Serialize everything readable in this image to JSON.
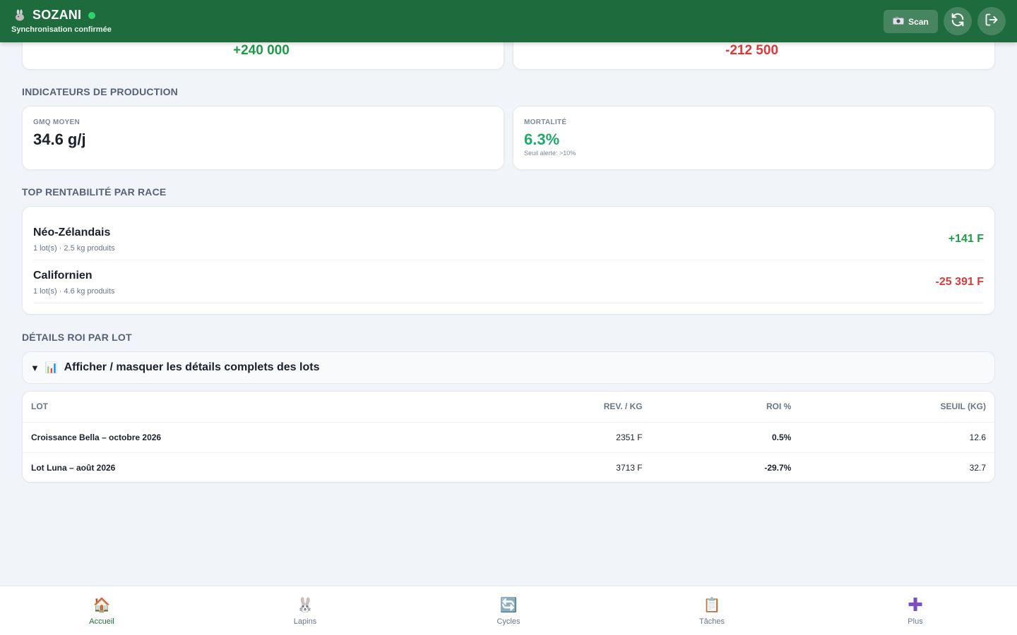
{
  "header": {
    "brand": "SOZANI",
    "subtitle": "Synchronisation confirmée",
    "scan_label": "Scan",
    "brand_icon": "rabbit-icon",
    "colors": {
      "bar": "#1e6b3e",
      "status": "#2fd26b"
    }
  },
  "summary": {
    "left_value": "+240 000",
    "right_value": "-212 500"
  },
  "production": {
    "title": "INDICATEURS DE PRODUCTION",
    "gmq": {
      "label": "GMQ MOYEN",
      "value": "34.6 g/j"
    },
    "mortality": {
      "label": "MORTALITÉ",
      "value": "6.3%",
      "note": "Seuil alerte: >10%"
    }
  },
  "top_race": {
    "title": "TOP RENTABILITÉ PAR RACE",
    "items": [
      {
        "name": "Néo-Zélandais",
        "meta": "1 lot(s) · 2.5 kg produits",
        "value": "+141 F"
      },
      {
        "name": "Californien",
        "meta": "1 lot(s) · 4.6 kg produits",
        "value": "-25 391 F"
      }
    ]
  },
  "roi": {
    "title": "DÉTAILS ROI PAR LOT",
    "toggle_arrow": "▼",
    "toggle_icon": "📊",
    "toggle_label": "Afficher / masquer les détails complets des lots",
    "headers": [
      "LOT",
      "REV. / KG",
      "ROI %",
      "SEUIL (KG)"
    ],
    "rows": [
      [
        "Croissance Bella – octobre 2026",
        "2351 F",
        "0.5%",
        "12.6"
      ],
      [
        "Lot Luna – août 2026",
        "3713 F",
        "-29.7%",
        "32.7"
      ]
    ]
  },
  "nav": {
    "items": [
      {
        "label": "Accueil",
        "icon": "🏠",
        "icon_name": "home-icon"
      },
      {
        "label": "Lapins",
        "icon": "🐰",
        "icon_name": "rabbit-icon"
      },
      {
        "label": "Cycles",
        "icon": "🔄",
        "icon_name": "cycle-icon"
      },
      {
        "label": "Tâches",
        "icon": "📋",
        "icon_name": "clipboard-icon"
      },
      {
        "label": "Plus",
        "icon": "✚",
        "icon_name": "plus-icon"
      }
    ]
  }
}
